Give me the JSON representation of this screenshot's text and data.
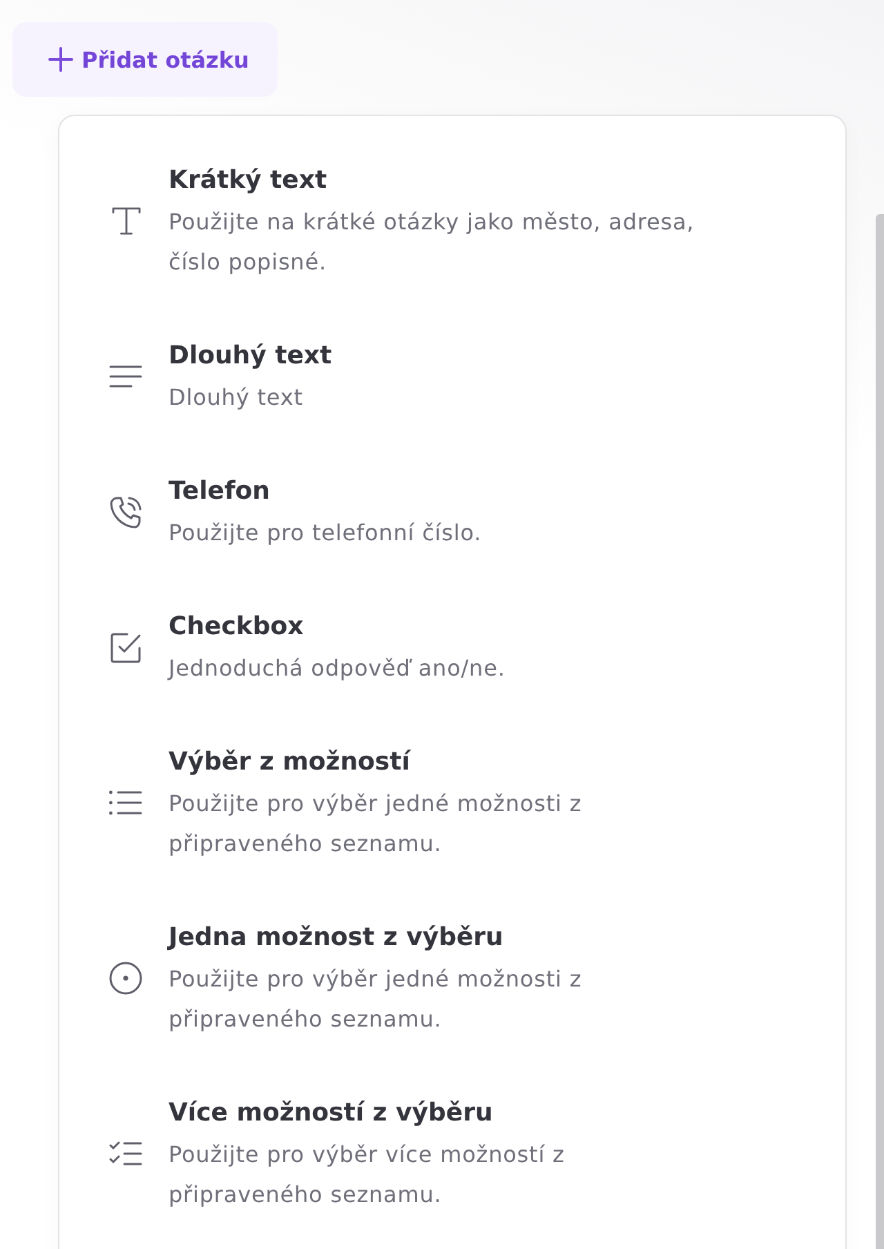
{
  "add_button": {
    "label": "Přidat otázku"
  },
  "menu": {
    "items": [
      {
        "kind": "short_text",
        "title": "Krátký text",
        "description": "Použijte na krátké otázky jako město, adresa, číslo popisné."
      },
      {
        "kind": "long_text",
        "title": "Dlouhý text",
        "description": "Dlouhý text"
      },
      {
        "kind": "phone",
        "title": "Telefon",
        "description": "Použijte pro telefonní číslo."
      },
      {
        "kind": "checkbox",
        "title": "Checkbox",
        "description": "Jednoduchá odpověď ano/ne."
      },
      {
        "kind": "select",
        "title": "Výběr z možností",
        "description": "Použijte pro výběr jedné možnosti z připraveného seznamu."
      },
      {
        "kind": "radio",
        "title": "Jedna možnost z výběru",
        "description": "Použijte pro výběr jedné možnosti z připraveného seznamu."
      },
      {
        "kind": "multi",
        "title": "Více možností z výběru",
        "description": "Použijte pro výběr více možností z připraveného seznamu."
      }
    ]
  }
}
